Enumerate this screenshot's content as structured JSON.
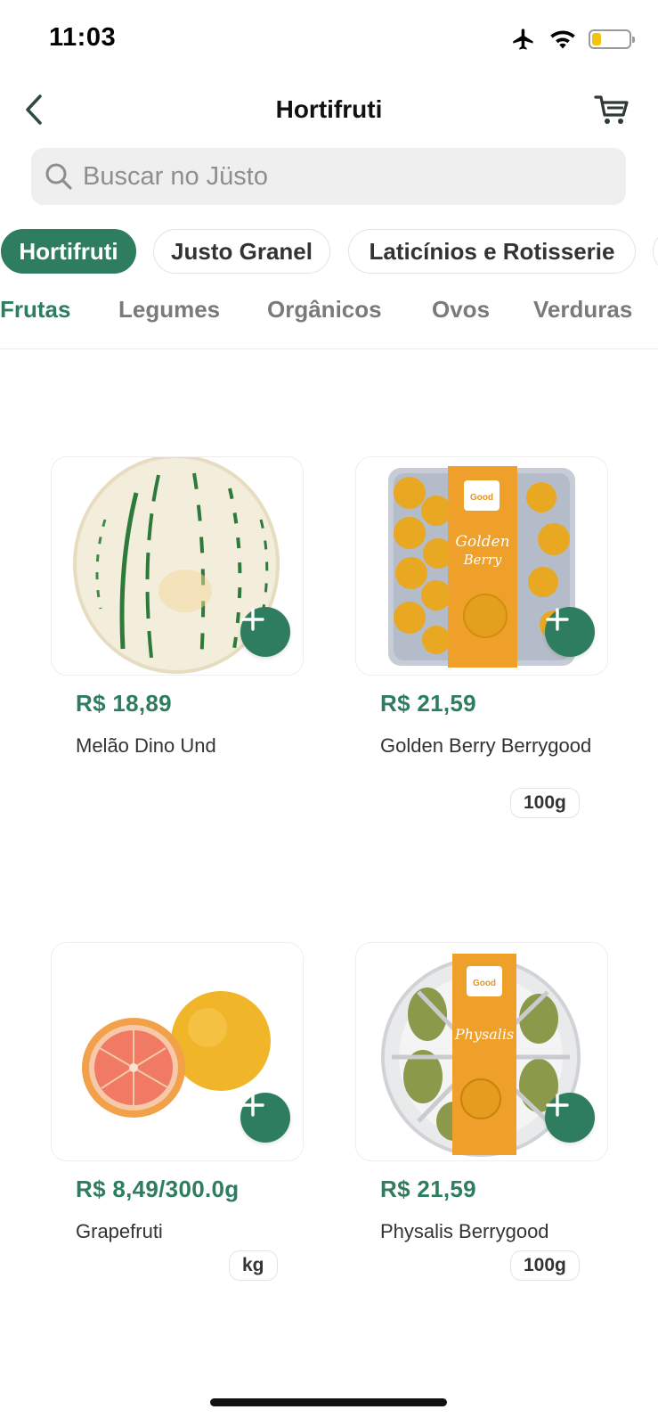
{
  "status_bar": {
    "time": "11:03",
    "icons": [
      "airplane-icon",
      "wifi-icon",
      "battery-icon"
    ],
    "battery_level": 0.26,
    "battery_color": "#f2c40f"
  },
  "header": {
    "title": "Hortifruti",
    "back_icon": "chevron-left-icon",
    "cart_icon": "cart-icon"
  },
  "search": {
    "placeholder": "Buscar no Jüsto",
    "icon": "search-icon"
  },
  "categories": [
    {
      "label": "Hortifruti",
      "active": true
    },
    {
      "label": "Justo Granel",
      "active": false
    },
    {
      "label": "Laticínios e Rotisserie",
      "active": false
    }
  ],
  "subcategories": [
    {
      "label": "Frutas",
      "active": true
    },
    {
      "label": "Legumes",
      "active": false
    },
    {
      "label": "Orgânicos",
      "active": false
    },
    {
      "label": "Ovos",
      "active": false
    },
    {
      "label": "Verduras",
      "active": false
    }
  ],
  "products": [
    {
      "price": "R$ 18,89",
      "name": "Melão Dino Und",
      "unit": ""
    },
    {
      "price": "R$ 21,59",
      "name": "Golden Berry Berrygood",
      "unit": "100g"
    },
    {
      "price": "R$ 8,49/300.0g",
      "name": "Grapefruti",
      "unit": "kg"
    },
    {
      "price": "R$ 21,59",
      "name": "Physalis Berrygood",
      "unit": "100g"
    }
  ],
  "colors": {
    "accent": "#2e7d5f",
    "tab_inactive": "#7a7a7a",
    "search_bg": "#efefef"
  }
}
